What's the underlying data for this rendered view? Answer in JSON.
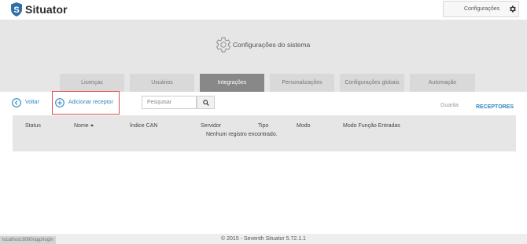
{
  "app": {
    "name": "Situator"
  },
  "topbar": {
    "config_label": "Configurações"
  },
  "header": {
    "title": "Configurações do sistema"
  },
  "tabs": [
    {
      "label": "Licenças",
      "active": false
    },
    {
      "label": "Usuários",
      "active": false
    },
    {
      "label": "Integrações",
      "active": true
    },
    {
      "label": "Personalizações",
      "active": false
    },
    {
      "label": "Configurações globais",
      "active": false
    },
    {
      "label": "Automação",
      "active": false
    }
  ],
  "toolbar": {
    "back_label": "Voltar",
    "add_label": "Adicionar receptor",
    "search_placeholder": "Pesquisar"
  },
  "subtabs": {
    "guarita": "Guarita",
    "receptores": "RECEPTORES",
    "active": "receptores"
  },
  "table": {
    "columns": [
      "Status",
      "Nome",
      "Índice CAN",
      "Servidor",
      "Tipo",
      "Modo",
      "Modo Função Entradas"
    ],
    "sorted_column": "Nome",
    "empty_message": "Nenhum registro encontrado."
  },
  "footer": {
    "copyright": "© 2015 - Seventh Situator 5.72.1.1",
    "status_url": "localhost:8080/app/login"
  },
  "colors": {
    "accent": "#2e86c1",
    "band": "#e6e6e6",
    "active_tab": "#888888",
    "highlight_box": "#d9534f"
  }
}
